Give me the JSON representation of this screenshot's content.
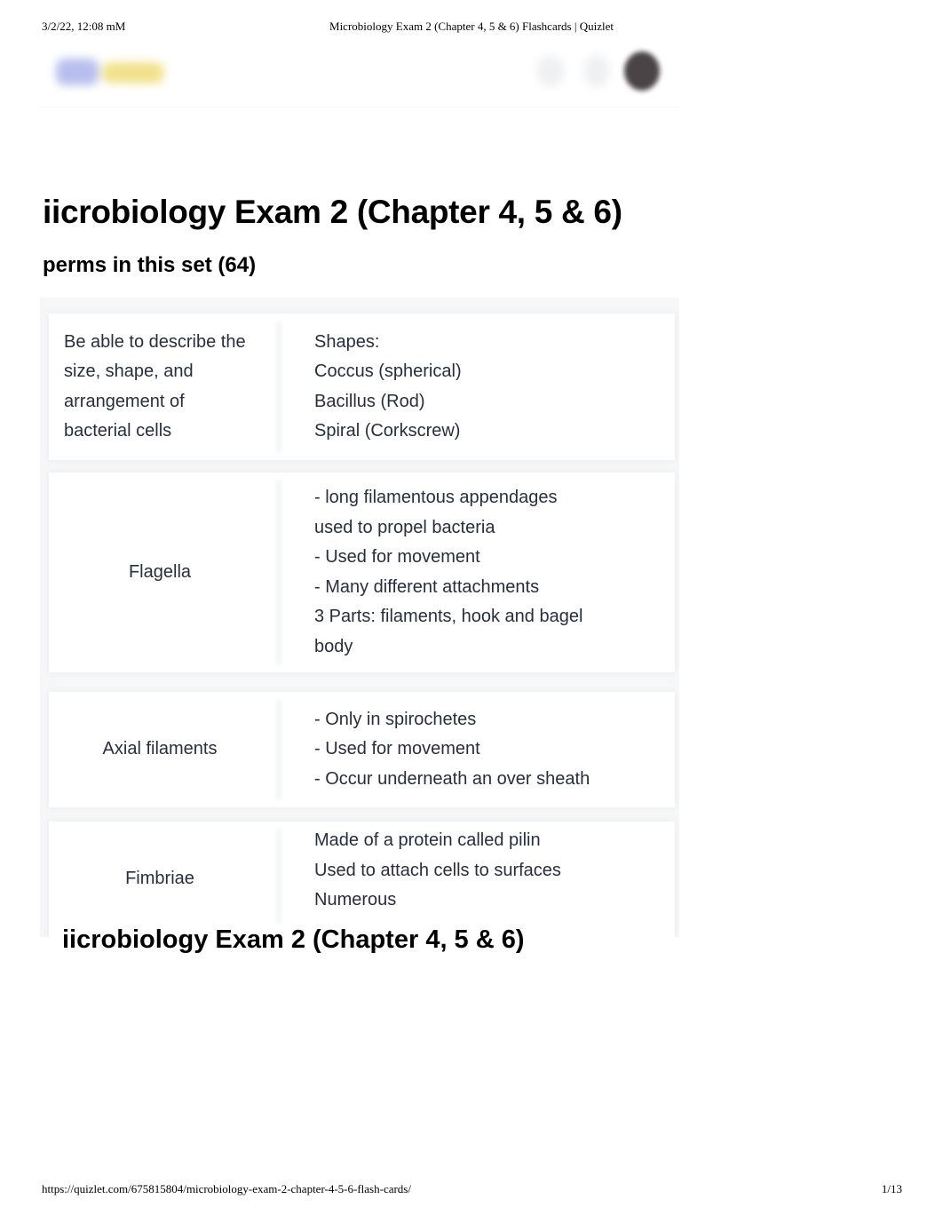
{
  "print_header": {
    "datetime": "3/2/22, 12:08 mM",
    "page_title": "Microbiology Exam 2 (Chapter 4, 5 & 6) Flashcards | Quizlet"
  },
  "topbar": {
    "logo": "quizlet-plus-logo",
    "icons": [
      "search-icon",
      "notifications-icon"
    ],
    "avatar": "user-avatar"
  },
  "set": {
    "title": "iicrobiology Exam 2 (Chapter 4, 5 & 6)",
    "terms_heading": "perms in this set (64)"
  },
  "cards": [
    {
      "term": "Be able to describe the size, shape, and arrangement of bacterial cells",
      "definition": [
        "Shapes:",
        "Coccus (spherical)",
        "Bacillus (Rod)",
        "Spiral (Corkscrew)"
      ]
    },
    {
      "term": "Flagella",
      "definition": [
        "- long filamentous appendages",
        "used to propel bacteria",
        "- Used for movement",
        "- Many different attachments",
        "3 Parts: filaments, hook and bagel",
        "body"
      ]
    },
    {
      "term": "Axial filaments",
      "definition": [
        "- Only in spirochetes",
        "- Used for movement",
        "- Occur underneath an over sheath"
      ]
    },
    {
      "term": "Fimbriae",
      "definition": [
        "Made of a protein called pilin",
        "Used to attach cells to surfaces",
        "Numerous"
      ]
    }
  ],
  "repeat_title": "iicrobiology Exam 2 (Chapter 4, 5 & 6)",
  "print_footer": {
    "url": "https://quizlet.com/675815804/microbiology-exam-2-chapter-4-5-6-flash-cards/",
    "page": "1/13"
  }
}
